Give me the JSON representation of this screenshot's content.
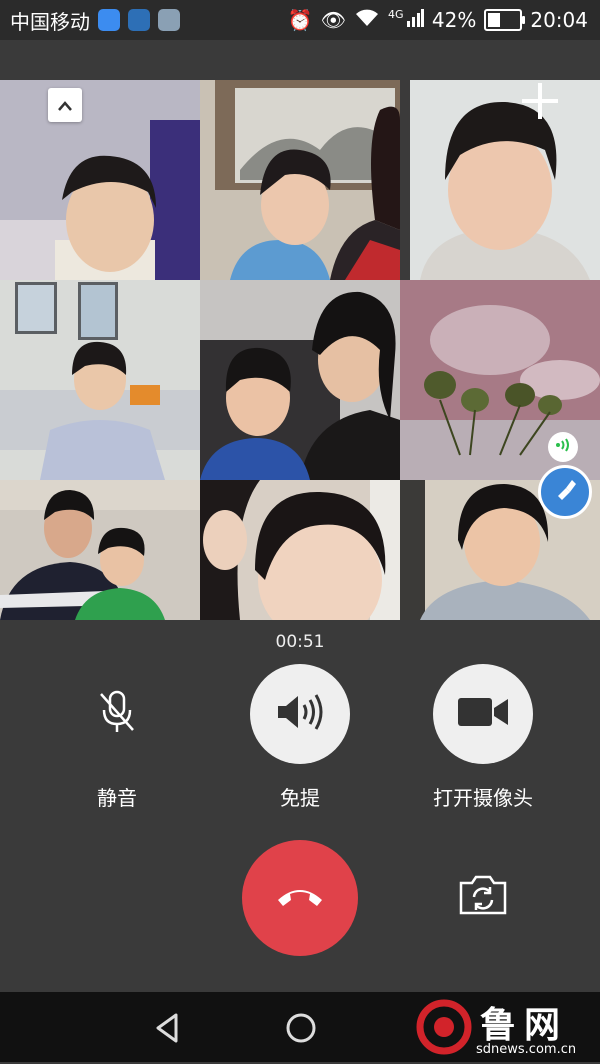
{
  "status_bar": {
    "carrier": "中国移动",
    "network": "4G",
    "battery": "42%",
    "battery_level": 0.42,
    "time": "20:04"
  },
  "call": {
    "duration": "00:51",
    "participants": 9
  },
  "controls": {
    "mute_label": "静音",
    "speaker_label": "免提",
    "camera_label": "打开摄像头"
  },
  "icons": {
    "collapse": "chevron-up-icon",
    "add": "plus-icon",
    "mute": "microphone-off-icon",
    "speaker": "speaker-icon",
    "camera": "video-camera-icon",
    "end_call": "phone-hangup-icon",
    "switch_camera": "camera-switch-icon",
    "back": "back-triangle-icon",
    "home": "home-circle-icon"
  },
  "colors": {
    "end_call": "#e0424a",
    "float_button": "#3a85d6",
    "speaking": "#2bbf4c"
  },
  "watermark": {
    "name": "鲁网",
    "url": "sdnews.com.cn"
  }
}
